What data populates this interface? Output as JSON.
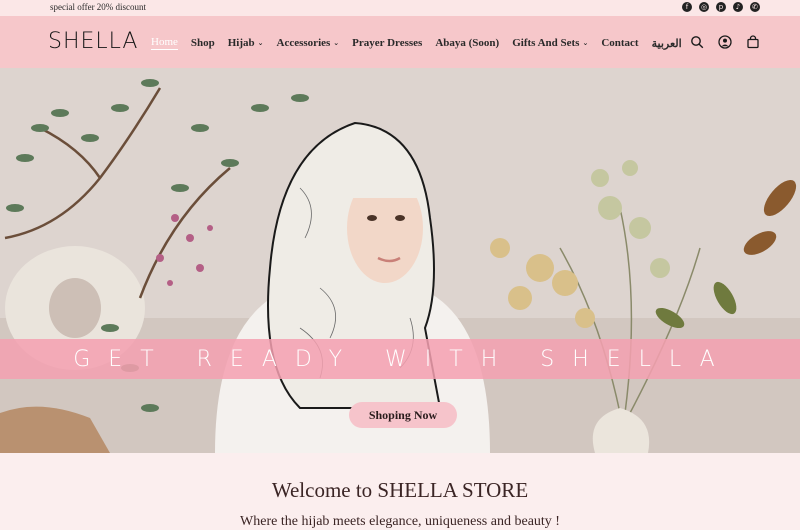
{
  "topbar": {
    "offer_text": "special offer 20% discount",
    "socials": [
      {
        "icon": "facebook-icon",
        "glyph": "f"
      },
      {
        "icon": "instagram-icon",
        "glyph": "◎"
      },
      {
        "icon": "pinterest-icon",
        "glyph": "p"
      },
      {
        "icon": "tiktok-icon",
        "glyph": "♪"
      },
      {
        "icon": "whatsapp-icon",
        "glyph": "✆"
      }
    ]
  },
  "header": {
    "logo": "SHELLA",
    "nav": [
      {
        "label": "Home",
        "active": true,
        "dropdown": false
      },
      {
        "label": "Shop",
        "active": false,
        "dropdown": false
      },
      {
        "label": "Hijab",
        "active": false,
        "dropdown": true
      },
      {
        "label": "Accessories",
        "active": false,
        "dropdown": true
      },
      {
        "label": "Prayer Dresses",
        "active": false,
        "dropdown": false
      },
      {
        "label": "Abaya (Soon)",
        "active": false,
        "dropdown": false
      },
      {
        "label": "Gifts And Sets",
        "active": false,
        "dropdown": true
      },
      {
        "label": "Contact",
        "active": false,
        "dropdown": false
      },
      {
        "label": "العربية",
        "active": false,
        "dropdown": false
      }
    ],
    "icons": [
      "search-icon",
      "account-icon",
      "cart-icon"
    ]
  },
  "hero": {
    "banner_text": "GET READY WITH SHELLA",
    "button_label": "Shoping Now"
  },
  "welcome": {
    "title": "Welcome to SHELLA STORE",
    "tagline": "Where the hijab meets elegance, uniqueness and beauty !"
  },
  "colors": {
    "header_bg": "#f6c7ca",
    "topbar_bg": "#fbe7e7",
    "banner": "#f4a0b0",
    "page_bg": "#fbeeee"
  }
}
